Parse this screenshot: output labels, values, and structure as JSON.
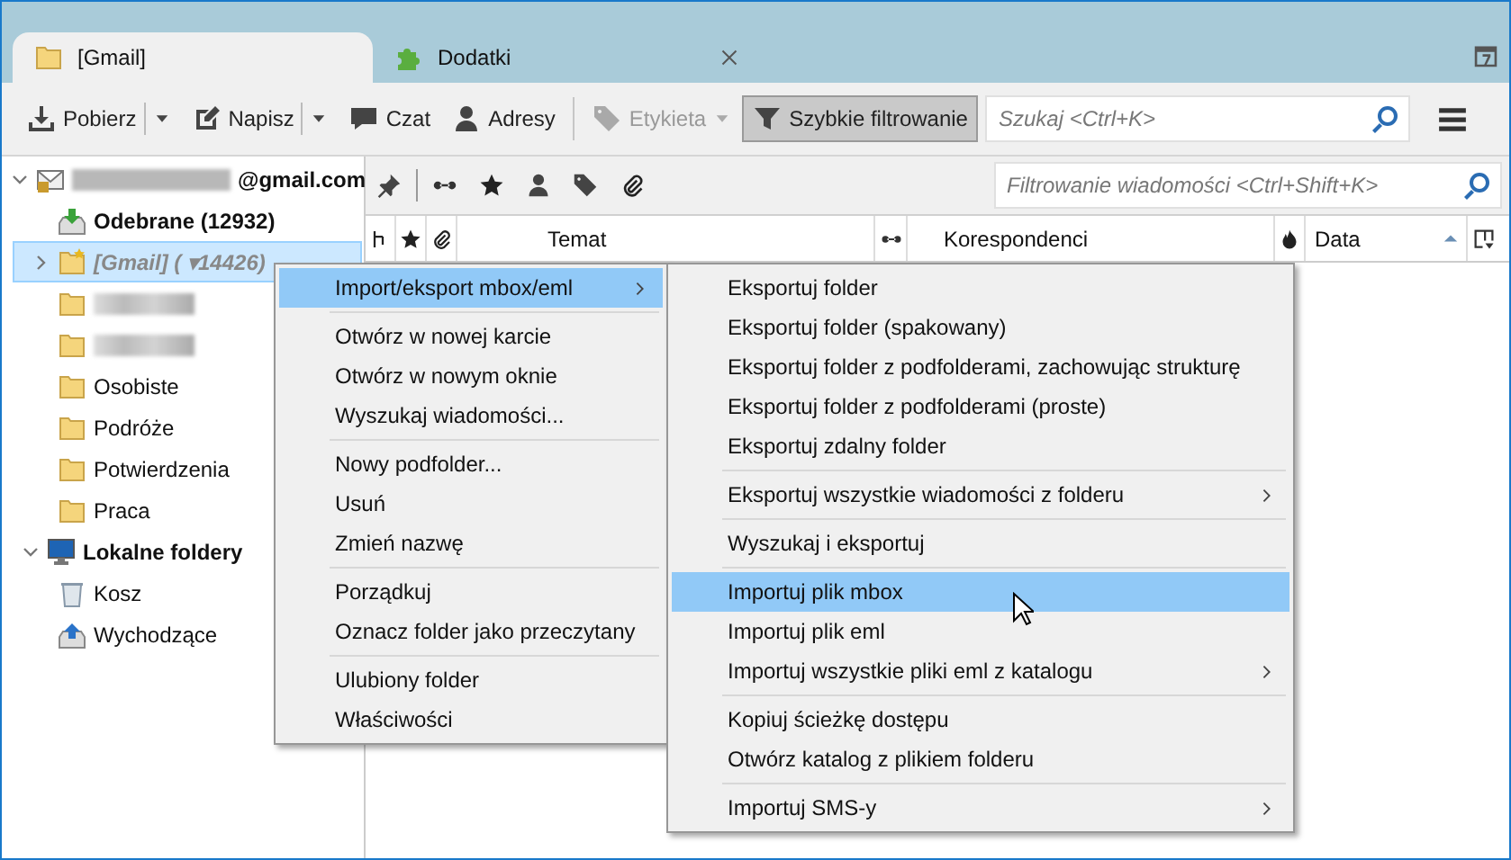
{
  "tabs": [
    {
      "label": "[Gmail]",
      "kind": "folder",
      "selected": true
    },
    {
      "label": "Dodatki",
      "kind": "addons",
      "selected": false
    }
  ],
  "toolbar": {
    "buttons": [
      {
        "label": "Pobierz",
        "kind": "get",
        "dropdown": true,
        "disabled": false,
        "pressed": false
      },
      {
        "label": "Napisz",
        "kind": "write",
        "dropdown": true,
        "disabled": false,
        "pressed": false
      },
      {
        "label": "Czat",
        "kind": "chat",
        "dropdown": false,
        "disabled": false,
        "pressed": false
      },
      {
        "label": "Adresy",
        "kind": "contacts",
        "dropdown": false,
        "disabled": false,
        "pressed": false
      },
      {
        "label": "Etykieta",
        "kind": "tag",
        "dropdown": true,
        "disabled": true,
        "pressed": false
      },
      {
        "label": "Szybkie filtrowanie",
        "kind": "filter",
        "dropdown": false,
        "disabled": false,
        "pressed": true
      }
    ],
    "search": {
      "placeholder": "Szukaj <Ctrl+K>"
    }
  },
  "folders": [
    {
      "label": "@gmail.com",
      "kind": "account",
      "redacted": true,
      "bold": true,
      "dimmed": false,
      "expanded": true,
      "selected": false,
      "children": [
        {
          "label": "Odebrane (12932)",
          "kind": "inbox",
          "redacted": false,
          "bold": true,
          "dimmed": false,
          "selected": false
        },
        {
          "label": "[Gmail] ( ▾14426)",
          "kind": "special",
          "redacted": false,
          "bold": true,
          "dimmed": true,
          "expanded": false,
          "selected": true
        },
        {
          "kind": "folder",
          "redacted": true,
          "bold": false,
          "dimmed": false,
          "selected": false
        },
        {
          "kind": "folder",
          "redacted": true,
          "bold": false,
          "dimmed": false,
          "selected": false
        },
        {
          "label": "Osobiste",
          "kind": "folder",
          "redacted": false,
          "bold": false,
          "dimmed": false,
          "selected": false
        },
        {
          "label": "Podróże",
          "kind": "folder",
          "redacted": false,
          "bold": false,
          "dimmed": false,
          "selected": false
        },
        {
          "label": "Potwierdzenia",
          "kind": "folder",
          "redacted": false,
          "bold": false,
          "dimmed": false,
          "selected": false
        },
        {
          "label": "Praca",
          "kind": "folder",
          "redacted": false,
          "bold": false,
          "dimmed": false,
          "selected": false
        }
      ]
    },
    {
      "label": "Lokalne foldery",
      "kind": "local",
      "redacted": false,
      "bold": true,
      "dimmed": false,
      "expanded": true,
      "selected": false,
      "children": [
        {
          "label": "Kosz",
          "kind": "trash",
          "redacted": false,
          "bold": false,
          "dimmed": false,
          "selected": false
        },
        {
          "label": "Wychodzące",
          "kind": "outbox",
          "redacted": false,
          "bold": false,
          "dimmed": false,
          "selected": false
        }
      ]
    }
  ],
  "quick_filter": {
    "placeholder": "Filtrowanie wiadomości <Ctrl+Shift+K>"
  },
  "columns": [
    {
      "kind": "thread"
    },
    {
      "kind": "star"
    },
    {
      "kind": "attachment"
    },
    {
      "kind": "text",
      "label": "Temat",
      "sorted": false
    },
    {
      "kind": "read"
    },
    {
      "kind": "text",
      "label": "Korespondenci",
      "sorted": false
    },
    {
      "kind": "junk"
    },
    {
      "kind": "text",
      "label": "Data",
      "sorted": true
    },
    {
      "kind": "picker"
    }
  ],
  "context_menu": {
    "items": [
      {
        "kind": "item",
        "label": "Import/eksport mbox/eml",
        "submenu": true,
        "selected": true
      },
      {
        "kind": "separator"
      },
      {
        "kind": "item",
        "label": "Otwórz w nowej karcie",
        "submenu": false,
        "selected": false
      },
      {
        "kind": "item",
        "label": "Otwórz w nowym oknie",
        "submenu": false,
        "selected": false
      },
      {
        "kind": "item",
        "label": "Wyszukaj wiadomości...",
        "submenu": false,
        "selected": false
      },
      {
        "kind": "separator"
      },
      {
        "kind": "item",
        "label": "Nowy podfolder...",
        "submenu": false,
        "selected": false
      },
      {
        "kind": "item",
        "label": "Usuń",
        "submenu": false,
        "selected": false
      },
      {
        "kind": "item",
        "label": "Zmień nazwę",
        "submenu": false,
        "selected": false
      },
      {
        "kind": "separator"
      },
      {
        "kind": "item",
        "label": "Porządkuj",
        "submenu": false,
        "selected": false
      },
      {
        "kind": "item",
        "label": "Oznacz folder jako przeczytany",
        "submenu": false,
        "selected": false
      },
      {
        "kind": "separator"
      },
      {
        "kind": "item",
        "label": "Ulubiony folder",
        "submenu": false,
        "selected": false
      },
      {
        "kind": "item",
        "label": "Właściwości",
        "submenu": false,
        "selected": false
      }
    ]
  },
  "submenu": {
    "items": [
      {
        "kind": "item",
        "label": "Eksportuj folder",
        "submenu": false,
        "selected": false
      },
      {
        "kind": "item",
        "label": "Eksportuj folder (spakowany)",
        "submenu": false,
        "selected": false
      },
      {
        "kind": "item",
        "label": "Eksportuj folder z podfolderami, zachowując strukturę",
        "submenu": false,
        "selected": false
      },
      {
        "kind": "item",
        "label": "Eksportuj folder z podfolderami (proste)",
        "submenu": false,
        "selected": false
      },
      {
        "kind": "item",
        "label": "Eksportuj zdalny folder",
        "submenu": false,
        "selected": false
      },
      {
        "kind": "separator"
      },
      {
        "kind": "item",
        "label": "Eksportuj wszystkie wiadomości z folderu",
        "submenu": true,
        "selected": false
      },
      {
        "kind": "separator"
      },
      {
        "kind": "item",
        "label": "Wyszukaj i eksportuj",
        "submenu": false,
        "selected": false
      },
      {
        "kind": "separator"
      },
      {
        "kind": "item",
        "label": "Importuj plik mbox",
        "submenu": false,
        "selected": true
      },
      {
        "kind": "item",
        "label": "Importuj plik eml",
        "submenu": false,
        "selected": false
      },
      {
        "kind": "item",
        "label": "Importuj wszystkie pliki eml z katalogu",
        "submenu": true,
        "selected": false
      },
      {
        "kind": "separator"
      },
      {
        "kind": "item",
        "label": "Kopiuj ścieżkę dostępu",
        "submenu": false,
        "selected": false
      },
      {
        "kind": "item",
        "label": "Otwórz katalog z plikiem folderu",
        "submenu": false,
        "selected": false
      },
      {
        "kind": "separator"
      },
      {
        "kind": "item",
        "label": "Importuj SMS-y",
        "submenu": true,
        "selected": false
      }
    ]
  }
}
